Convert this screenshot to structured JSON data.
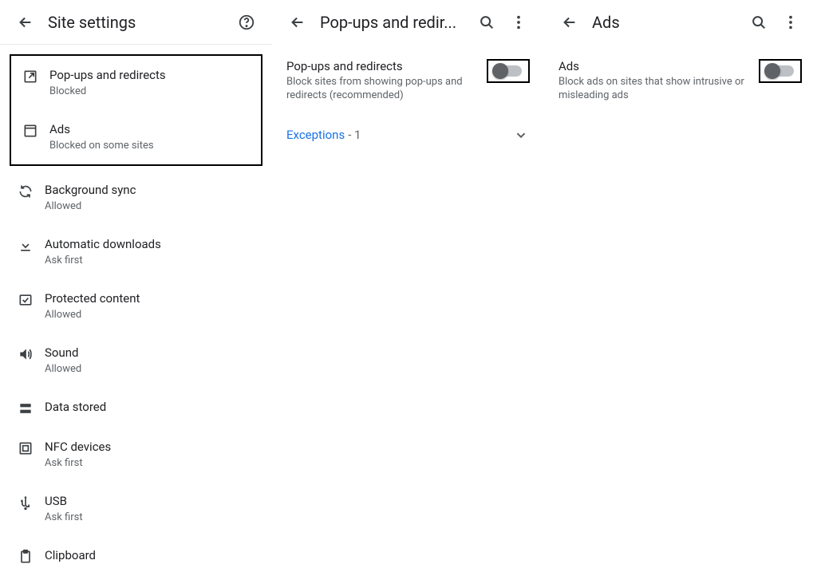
{
  "panel1": {
    "title": "Site settings",
    "items": [
      {
        "title": "Pop-ups and redirects",
        "sub": "Blocked"
      },
      {
        "title": "Ads",
        "sub": "Blocked on some sites"
      },
      {
        "title": "Background sync",
        "sub": "Allowed"
      },
      {
        "title": "Automatic downloads",
        "sub": "Ask first"
      },
      {
        "title": "Protected content",
        "sub": "Allowed"
      },
      {
        "title": "Sound",
        "sub": "Allowed"
      },
      {
        "title": "Data stored",
        "sub": ""
      },
      {
        "title": "NFC devices",
        "sub": "Ask first"
      },
      {
        "title": "USB",
        "sub": "Ask first"
      },
      {
        "title": "Clipboard",
        "sub": ""
      }
    ]
  },
  "panel2": {
    "title": "Pop-ups and redir...",
    "setting_title": "Pop-ups and redirects",
    "setting_sub": "Block sites from showing pop-ups and redirects (recommended)",
    "exceptions_label": "Exceptions",
    "exceptions_count": "- 1"
  },
  "panel3": {
    "title": "Ads",
    "setting_title": "Ads",
    "setting_sub": "Block ads on sites that show intrusive or misleading ads"
  }
}
